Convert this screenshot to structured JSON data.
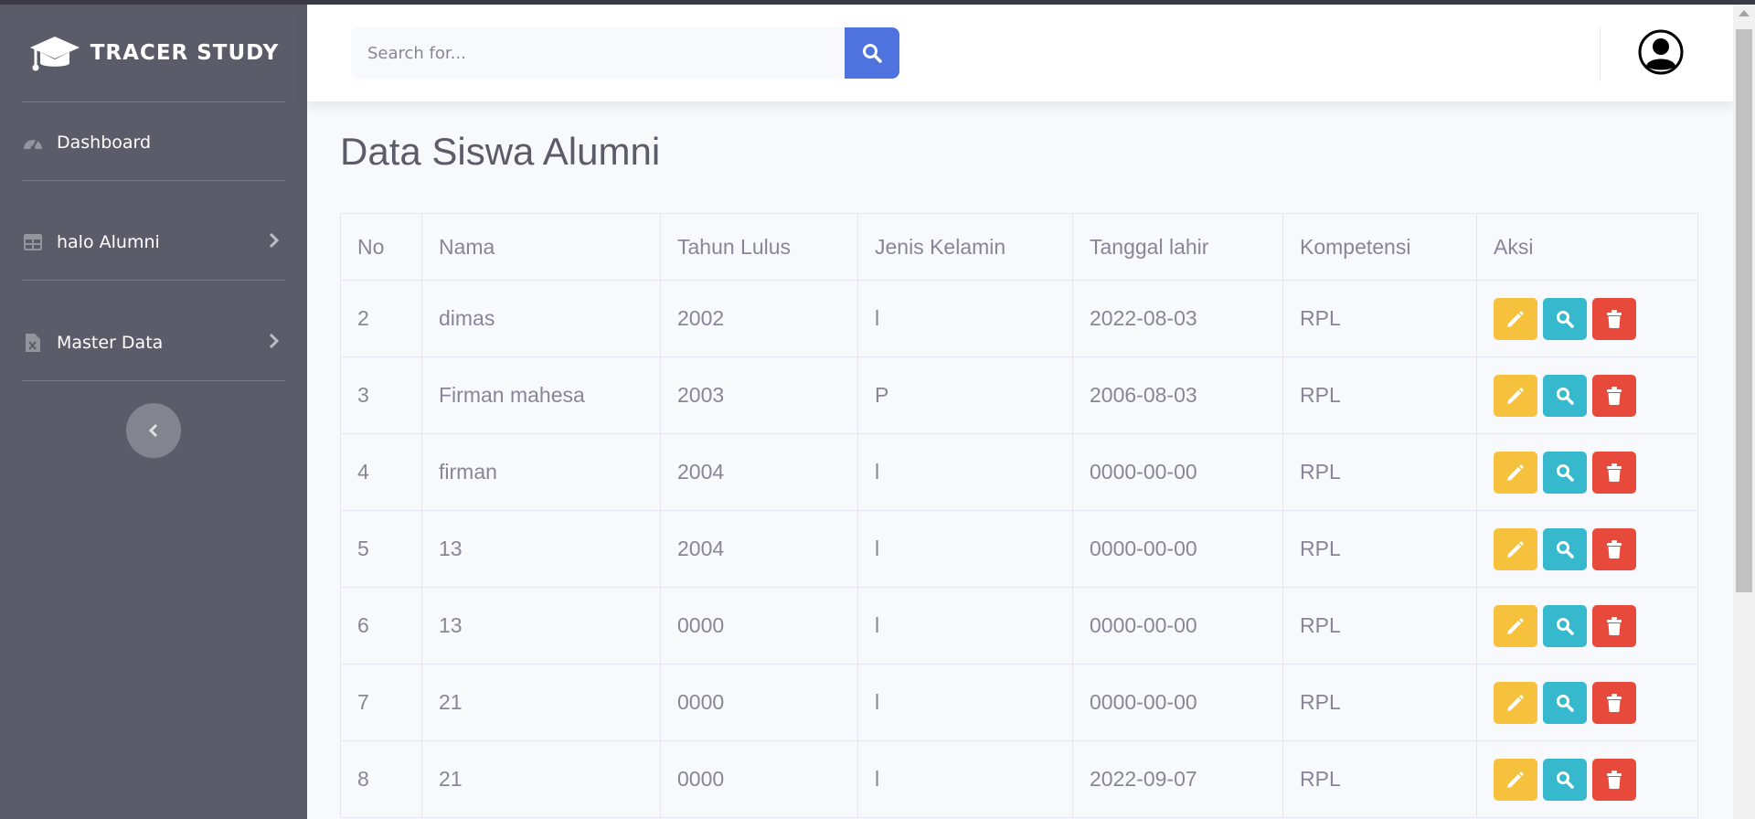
{
  "brand": {
    "title": "TRACER STUDY"
  },
  "sidebar": {
    "items": [
      {
        "label": "Dashboard",
        "icon": "tachometer-icon"
      },
      {
        "label": "halo Alumni",
        "icon": "table-icon"
      },
      {
        "label": "Master Data",
        "icon": "file-excel-icon"
      }
    ]
  },
  "search": {
    "placeholder": "Search for..."
  },
  "main": {
    "title": "Data Siswa Alumni",
    "columns": [
      "No",
      "Nama",
      "Tahun Lulus",
      "Jenis Kelamin",
      "Tanggal lahir",
      "Kompetensi",
      "Aksi"
    ],
    "rows": [
      [
        "2",
        "dimas",
        "2002",
        "l",
        "2022-08-03",
        "RPL"
      ],
      [
        "3",
        "Firman mahesa",
        "2003",
        "P",
        "2006-08-03",
        "RPL"
      ],
      [
        "4",
        "firman",
        "2004",
        "l",
        "0000-00-00",
        "RPL"
      ],
      [
        "5",
        "13",
        "2004",
        "l",
        "0000-00-00",
        "RPL"
      ],
      [
        "6",
        "13",
        "0000",
        "l",
        "0000-00-00",
        "RPL"
      ],
      [
        "7",
        "21",
        "0000",
        "l",
        "0000-00-00",
        "RPL"
      ],
      [
        "8",
        "21",
        "0000",
        "l",
        "2022-09-07",
        "RPL"
      ]
    ]
  },
  "colors": {
    "sidebar_bg": "#5a5c69",
    "primary": "#4e73df",
    "warning": "#f6c23e",
    "info": "#36b9cc",
    "danger": "#e74a3b"
  }
}
